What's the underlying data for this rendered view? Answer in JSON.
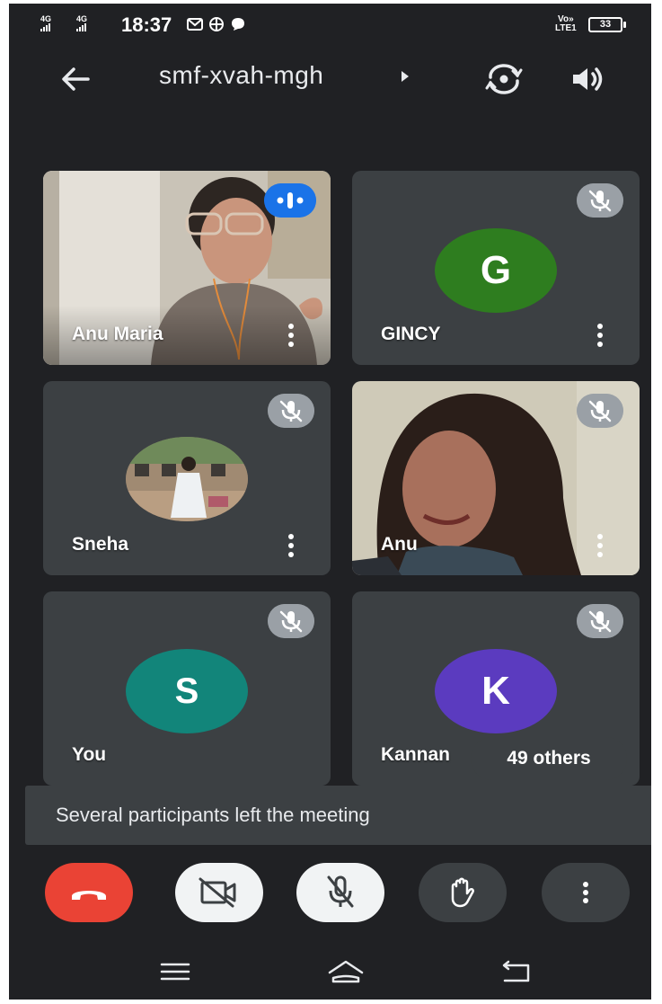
{
  "status_bar": {
    "sim1_network": "4G",
    "sim2_network": "4G",
    "time": "18:37",
    "icons": [
      "gmail-icon",
      "vpn-icon",
      "chat-bubble-icon"
    ],
    "volte_top": "Vo»",
    "volte_bottom": "LTE1",
    "battery": "33"
  },
  "app_bar": {
    "back_icon": "arrow-left-icon",
    "meeting_code": "smf-xvah-mgh",
    "switch_camera_icon": "switch-camera-icon",
    "speaker_icon": "speaker-icon"
  },
  "participants": [
    {
      "name": "Anu Maria",
      "type": "video",
      "state": "speaking"
    },
    {
      "name": "GINCY",
      "type": "avatar",
      "initial": "G",
      "color": "#2e7d1f",
      "state": "muted"
    },
    {
      "name": "Sneha",
      "type": "photo",
      "state": "muted"
    },
    {
      "name": "Anu",
      "type": "video",
      "state": "muted"
    },
    {
      "name": "You",
      "type": "avatar",
      "initial": "S",
      "color": "#12857a",
      "state": "muted"
    },
    {
      "name": "Kannan",
      "type": "avatar",
      "initial": "K",
      "color": "#5b3bbf",
      "state": "muted"
    }
  ],
  "others_chip": "49 others",
  "toast": "Several participants left the meeting",
  "controls": {
    "end_call": "end-call-icon",
    "camera": "camera-off-icon",
    "mic": "mic-off-icon",
    "raise_hand": "hand-icon",
    "more": "more-vertical-icon"
  },
  "nav_bar": [
    "menu-icon",
    "home-icon",
    "back-icon"
  ]
}
